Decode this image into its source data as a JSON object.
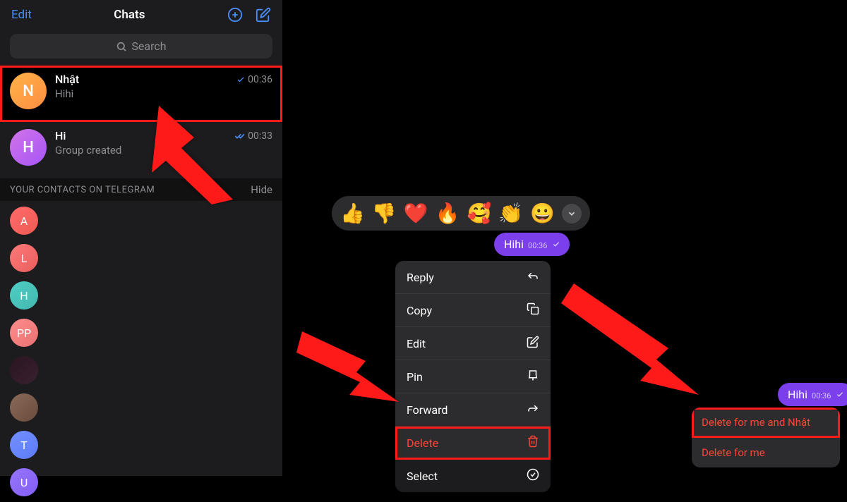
{
  "header": {
    "edit": "Edit",
    "title": "Chats"
  },
  "search": {
    "placeholder": "Search"
  },
  "chats": [
    {
      "name": "Nhật",
      "preview": "Hihi",
      "time": "00:36",
      "avatar_letter": "N",
      "avatar_bg": "linear-gradient(135deg,#ffb347,#ff8c42)",
      "highlighted": true,
      "checks": 1
    },
    {
      "name": "Hi",
      "preview": "Group created",
      "time": "00:33",
      "avatar_letter": "H",
      "avatar_bg": "linear-gradient(135deg,#d074e8,#a855f7)",
      "highlighted": false,
      "checks": 2
    }
  ],
  "section": {
    "title": "YOUR CONTACTS ON TELEGRAM",
    "hide": "Hide"
  },
  "contacts": [
    {
      "letter": "A",
      "bg": "linear-gradient(135deg,#ff6b6b,#ee5a52)"
    },
    {
      "letter": "L",
      "bg": "linear-gradient(135deg,#ff7a7a,#e85d5d)"
    },
    {
      "letter": "H",
      "bg": "linear-gradient(135deg,#4ecdc4,#44b8b0)"
    },
    {
      "letter": "PP",
      "bg": "linear-gradient(135deg,#ff8e8e,#e87070)"
    },
    {
      "letter": "",
      "bg": "linear-gradient(135deg,#2a1520,#3a2030)"
    },
    {
      "letter": "",
      "bg": "linear-gradient(135deg,#8a6a5a,#6a4a3a)"
    },
    {
      "letter": "T",
      "bg": "linear-gradient(135deg,#748ffc,#5c7cfa)"
    },
    {
      "letter": "U",
      "bg": "linear-gradient(135deg,#9775fa,#845ef7)"
    }
  ],
  "reactions": [
    "👍",
    "👎",
    "❤️",
    "🔥",
    "🥰",
    "👏",
    "😀"
  ],
  "message": {
    "text": "Hihi",
    "time": "00:36"
  },
  "context_menu": [
    {
      "label": "Reply",
      "icon": "reply"
    },
    {
      "label": "Copy",
      "icon": "copy"
    },
    {
      "label": "Edit",
      "icon": "edit"
    },
    {
      "label": "Pin",
      "icon": "pin"
    },
    {
      "label": "Forward",
      "icon": "forward"
    },
    {
      "label": "Delete",
      "icon": "trash",
      "delete": true,
      "highlighted": true
    },
    {
      "label": "Select",
      "icon": "select",
      "select": true
    }
  ],
  "delete_options": [
    {
      "label": "Delete for me and Nhật",
      "highlighted": true
    },
    {
      "label": "Delete for me",
      "highlighted": false
    }
  ],
  "colors": {
    "accent": "#4b8df8",
    "danger": "#ff453a",
    "highlight": "#ff1a1a"
  }
}
